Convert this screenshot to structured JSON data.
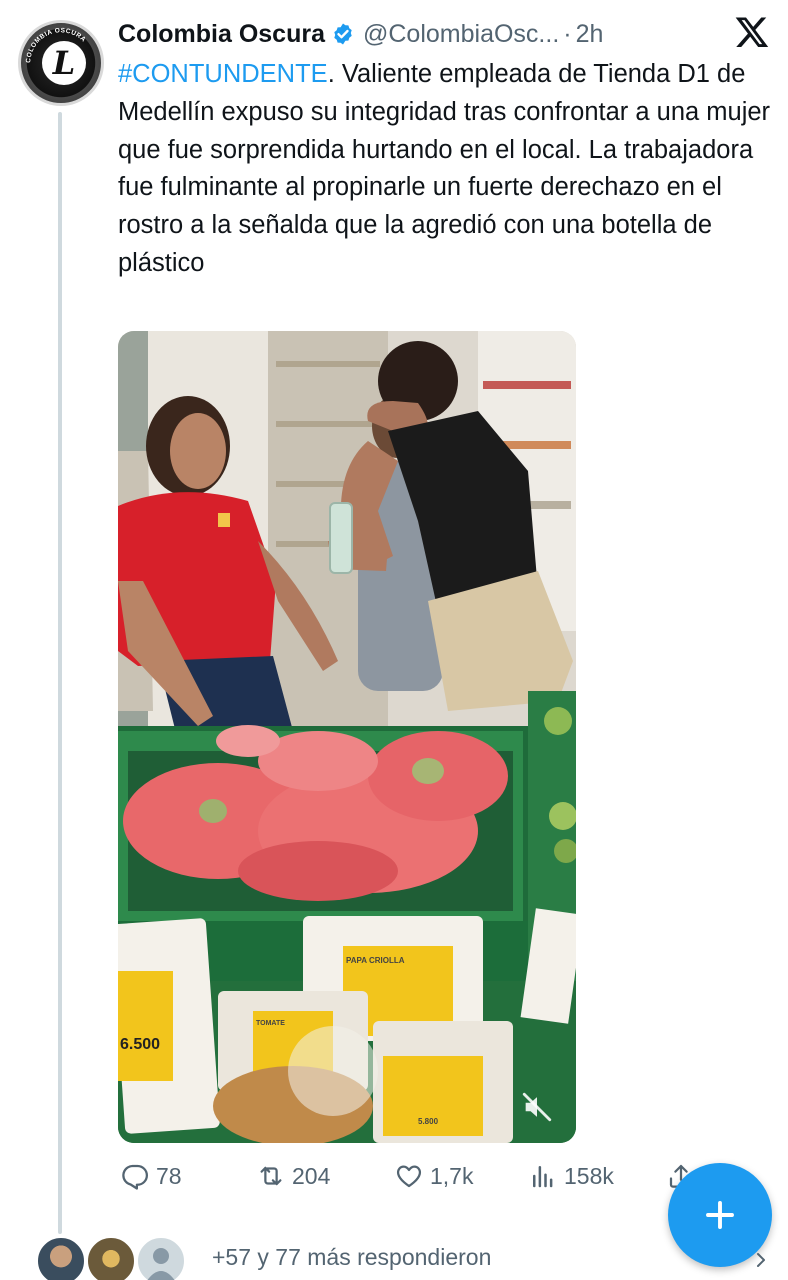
{
  "tweet": {
    "author_name": "Colombia Oscura",
    "handle": "@ColombiaOsc...",
    "separator": "·",
    "time": "2h",
    "avatar_text": "COLOMBIA OSCURA",
    "hashtag": "#CONTUNDENTE",
    "body": ". Valiente empleada de Tienda D1 de Medellín expuso su integridad tras confrontar a una mujer que fue sorprendida hurtando en el local. La trabajadora fue fulminante al propinarle un fuerte derechazo en el rostro a la señalda que la agredió con una botella de plástico",
    "media": {
      "sign_left_price": "6.500",
      "sign_center_label": "PAPA CRIOLLA",
      "sign_lower_label": "TOMATE",
      "sign_right_price": "5.800"
    }
  },
  "metrics": {
    "replies": "78",
    "reposts": "204",
    "likes": "1,7k",
    "views": "158k"
  },
  "icons": {
    "verified": "verified-badge-icon",
    "close": "x-logo-icon",
    "reply": "reply-icon",
    "repost": "repost-icon",
    "like": "heart-icon",
    "views": "views-icon",
    "share": "share-icon",
    "compose": "plus-icon",
    "mute": "mute-icon",
    "chevron": "chevron-right-icon"
  },
  "colors": {
    "accent": "#1d9bf0",
    "secondary_text": "#536471",
    "thread_line": "#cfd9de"
  },
  "replies_summary": "+57 y 77 más respondieron"
}
